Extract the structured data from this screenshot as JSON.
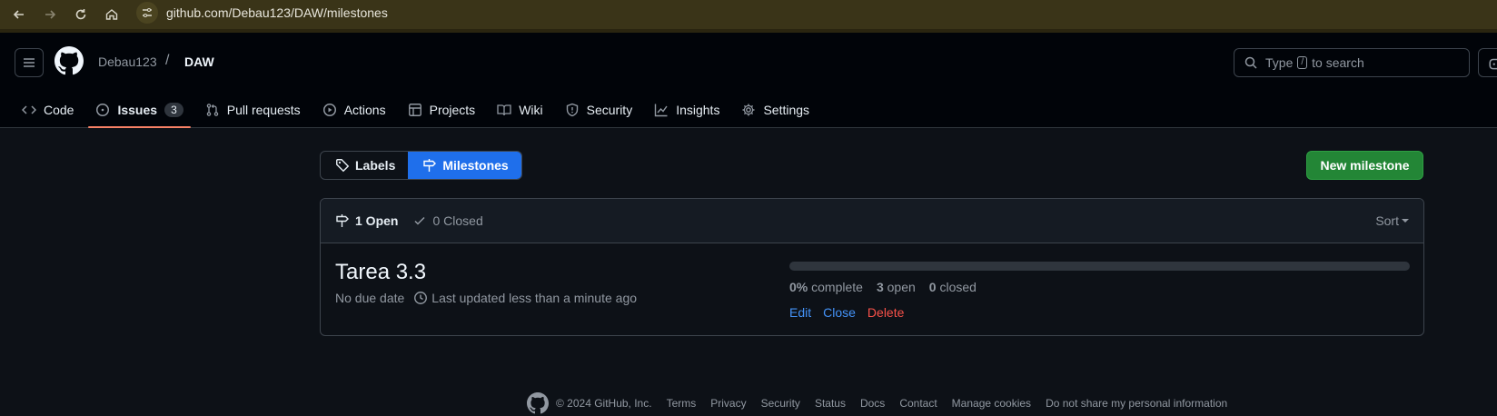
{
  "browser": {
    "url": "github.com/Debau123/DAW/milestones",
    "icons": [
      "back-icon",
      "forward-icon",
      "reload-icon",
      "home-icon",
      "site-settings-icon"
    ]
  },
  "header": {
    "owner": "Debau123",
    "separator": "/",
    "repo": "DAW",
    "search_prefix": "Type",
    "search_key": "/",
    "search_suffix": "to search"
  },
  "tabs": [
    {
      "label": "Code",
      "icon": "code-icon"
    },
    {
      "label": "Issues",
      "icon": "issue-opened-icon",
      "count": "3",
      "selected": true
    },
    {
      "label": "Pull requests",
      "icon": "git-pull-request-icon"
    },
    {
      "label": "Actions",
      "icon": "play-icon"
    },
    {
      "label": "Projects",
      "icon": "table-icon"
    },
    {
      "label": "Wiki",
      "icon": "book-icon"
    },
    {
      "label": "Security",
      "icon": "shield-icon"
    },
    {
      "label": "Insights",
      "icon": "graph-icon"
    },
    {
      "label": "Settings",
      "icon": "gear-icon"
    }
  ],
  "subnav": {
    "labels": "Labels",
    "milestones": "Milestones",
    "new_milestone": "New milestone"
  },
  "list": {
    "open": "1 Open",
    "closed": "0 Closed",
    "sort": "Sort"
  },
  "milestone": {
    "title": "Tarea 3.3",
    "due": "No due date",
    "updated": "Last updated less than a minute ago",
    "progress_percent": 0,
    "complete_value": "0%",
    "complete_label": "complete",
    "open_value": "3",
    "open_label": "open",
    "closed_value": "0",
    "closed_label": "closed",
    "edit": "Edit",
    "close": "Close",
    "delete": "Delete"
  },
  "footer": {
    "copyright": "© 2024 GitHub, Inc.",
    "links": [
      "Terms",
      "Privacy",
      "Security",
      "Status",
      "Docs",
      "Contact",
      "Manage cookies",
      "Do not share my personal information"
    ]
  },
  "colors": {
    "accent": "#1f6feb",
    "primary_button": "#238636",
    "link": "#4493f8",
    "danger": "#f85149",
    "selected_tab_underline": "#f78166"
  }
}
